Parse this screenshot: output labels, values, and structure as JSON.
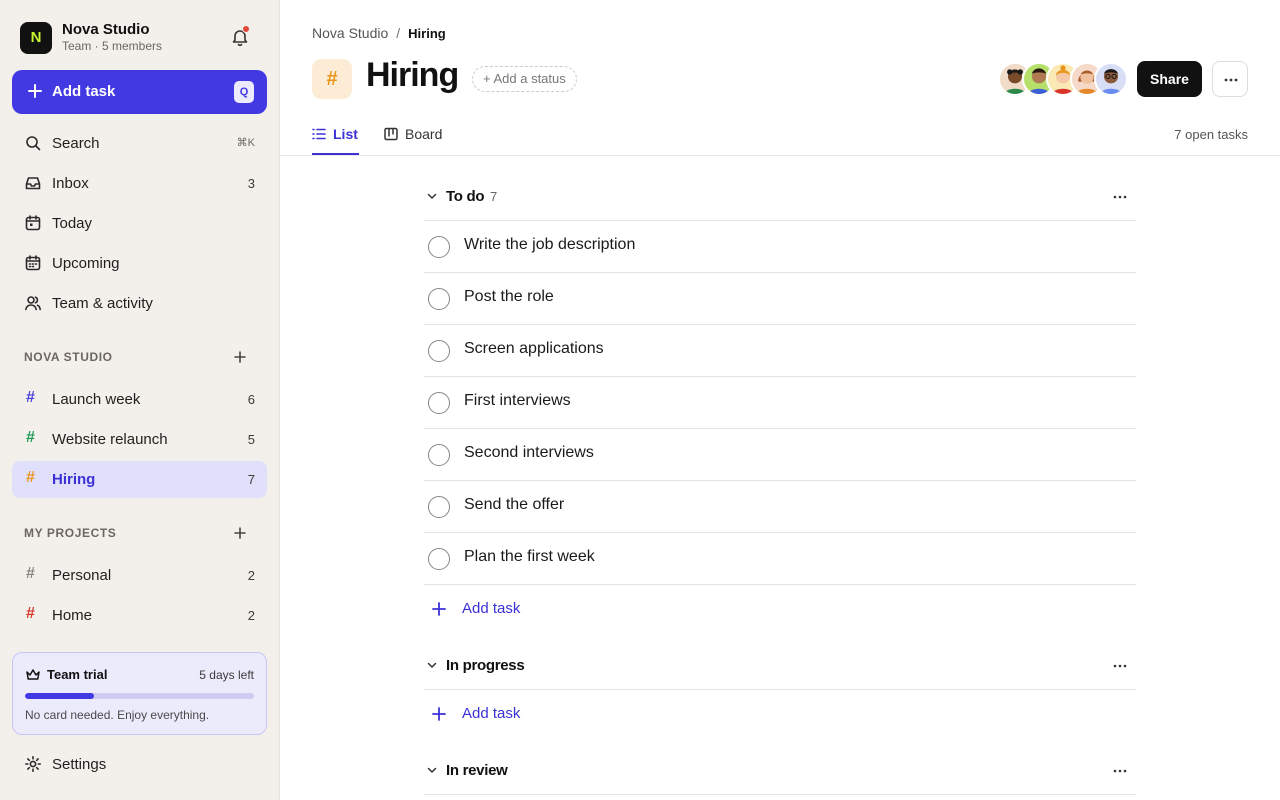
{
  "workspace": {
    "initial": "N",
    "name": "Nova Studio",
    "subtitle": "Team · 5 members"
  },
  "sidebar": {
    "add_task": {
      "label": "Add task",
      "shortcut": "Q"
    },
    "nav": [
      {
        "label": "Search",
        "shortcut": "⌘K",
        "icon": "search-icon"
      },
      {
        "label": "Inbox",
        "count": "3",
        "icon": "inbox-icon"
      },
      {
        "label": "Today",
        "icon": "calendar-today-icon"
      },
      {
        "label": "Upcoming",
        "icon": "calendar-upcoming-icon"
      },
      {
        "label": "Team & activity",
        "icon": "team-icon"
      }
    ],
    "team_section": {
      "heading": "NOVA STUDIO",
      "projects": [
        {
          "label": "Launch week",
          "count": "6",
          "color": "#4a3fe0"
        },
        {
          "label": "Website relaunch",
          "count": "5",
          "color": "#1f9a55"
        },
        {
          "label": "Hiring",
          "count": "7",
          "color": "#e8951a",
          "active": true
        }
      ]
    },
    "personal_section": {
      "heading": "MY PROJECTS",
      "projects": [
        {
          "label": "Personal",
          "count": "2",
          "color": "#8a8580"
        },
        {
          "label": "Home",
          "count": "2",
          "color": "#d9352b"
        }
      ]
    },
    "trial": {
      "title": "Team trial",
      "days_left": "5 days left",
      "progress": 0.3,
      "note": "No card needed. Enjoy everything."
    },
    "settings_label": "Settings"
  },
  "header": {
    "breadcrumb": {
      "parent": "Nova Studio",
      "separator": "/",
      "current": "Hiring"
    },
    "project_icon": "#",
    "title": "Hiring",
    "status_chip": "+ Add a status",
    "share_label": "Share",
    "tabs": [
      {
        "label": "List",
        "active": true
      },
      {
        "label": "Board"
      }
    ],
    "open_tasks": "7 open tasks"
  },
  "sections": {
    "todo": {
      "name": "To do",
      "count": "7",
      "tasks": [
        "Write the job description",
        "Post the role",
        "Screen applications",
        "First interviews",
        "Second interviews",
        "Send the offer",
        "Plan the first week"
      ],
      "add_label": "Add task"
    },
    "in_progress": {
      "name": "In progress",
      "add_label": "Add task"
    },
    "in_review": {
      "name": "In review"
    }
  },
  "colors": {
    "accent": "#4339e3",
    "accent_text": "#3b31d6",
    "sidebar_bg": "#f3f0eb",
    "project_hiring": "#e8951a"
  }
}
